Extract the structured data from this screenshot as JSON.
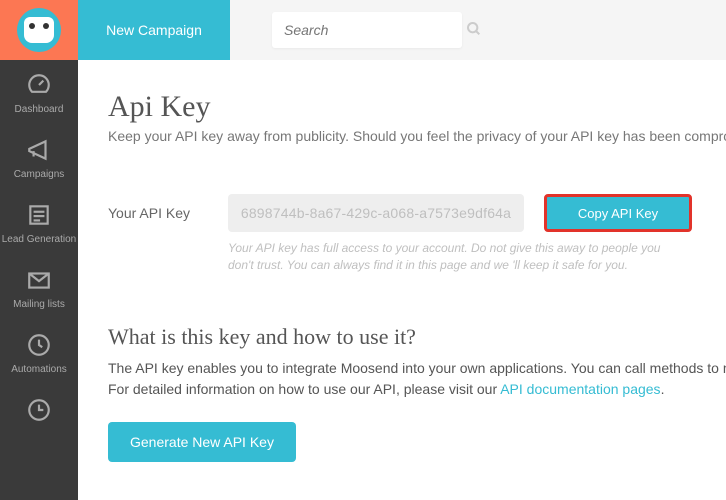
{
  "topbar": {
    "new_campaign": "New Campaign",
    "search_placeholder": "Search"
  },
  "sidebar": {
    "items": [
      {
        "label": "Dashboard"
      },
      {
        "label": "Campaigns"
      },
      {
        "label": "Lead Generation"
      },
      {
        "label": "Mailing lists"
      },
      {
        "label": "Automations"
      }
    ]
  },
  "page": {
    "title": "Api Key",
    "subtitle": "Keep your API key away from publicity. Should you feel the privacy of your API key has been compromise",
    "key_label": "Your API Key",
    "key_value": "6898744b-8a67-429c-a068-a7573e9df64a",
    "copy_btn": "Copy API Key",
    "note": "Your API key has full access to your account. Do not give this away to people you don't trust. You can always find it in this page and we 'll keep it safe for you.",
    "section_title": "What is this key and how to use it?",
    "desc_pre": "The API key enables you to integrate Moosend into your own applications. You can call methods to manip",
    "desc_line2_pre": "For detailed information on how to use our API, please visit our ",
    "doc_link": "API documentation pages",
    "generate_btn": "Generate New API Key"
  }
}
